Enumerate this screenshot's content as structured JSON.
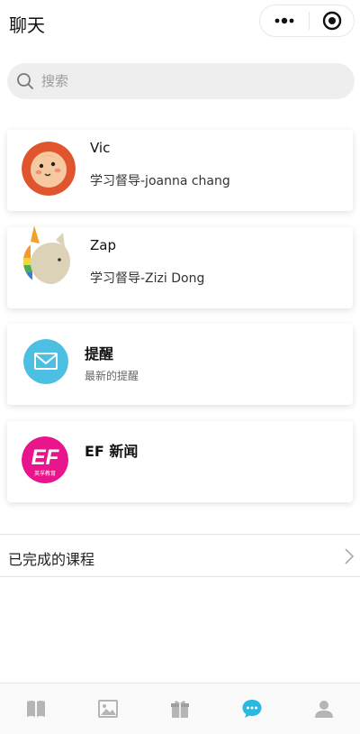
{
  "header": {
    "title": "聊天"
  },
  "search": {
    "placeholder": "搜索"
  },
  "chats": [
    {
      "name": "Vic",
      "subtitle": "学习督导-joanna chang"
    },
    {
      "name": "Zap",
      "subtitle": "学习督导-Zizi Dong"
    }
  ],
  "reminder": {
    "title": "提醒",
    "subtitle": "最新的提醒"
  },
  "news": {
    "title": "EF 新闻",
    "logo_text": "EF",
    "logo_subtext": "英孚教育"
  },
  "completed": {
    "label": "已完成的课程"
  },
  "tabs": [
    {
      "icon": "book-icon",
      "active": false
    },
    {
      "icon": "image-icon",
      "active": false
    },
    {
      "icon": "gift-icon",
      "active": false
    },
    {
      "icon": "chat-icon",
      "active": true
    },
    {
      "icon": "person-icon",
      "active": false
    }
  ],
  "colors": {
    "active_tab": "#2ab7e0",
    "inactive_tab": "#b5b5b5",
    "vic_avatar_bg": "#e0552d",
    "reminder_icon_bg": "#4cbfe3",
    "news_logo_bg": "#e8158c"
  }
}
